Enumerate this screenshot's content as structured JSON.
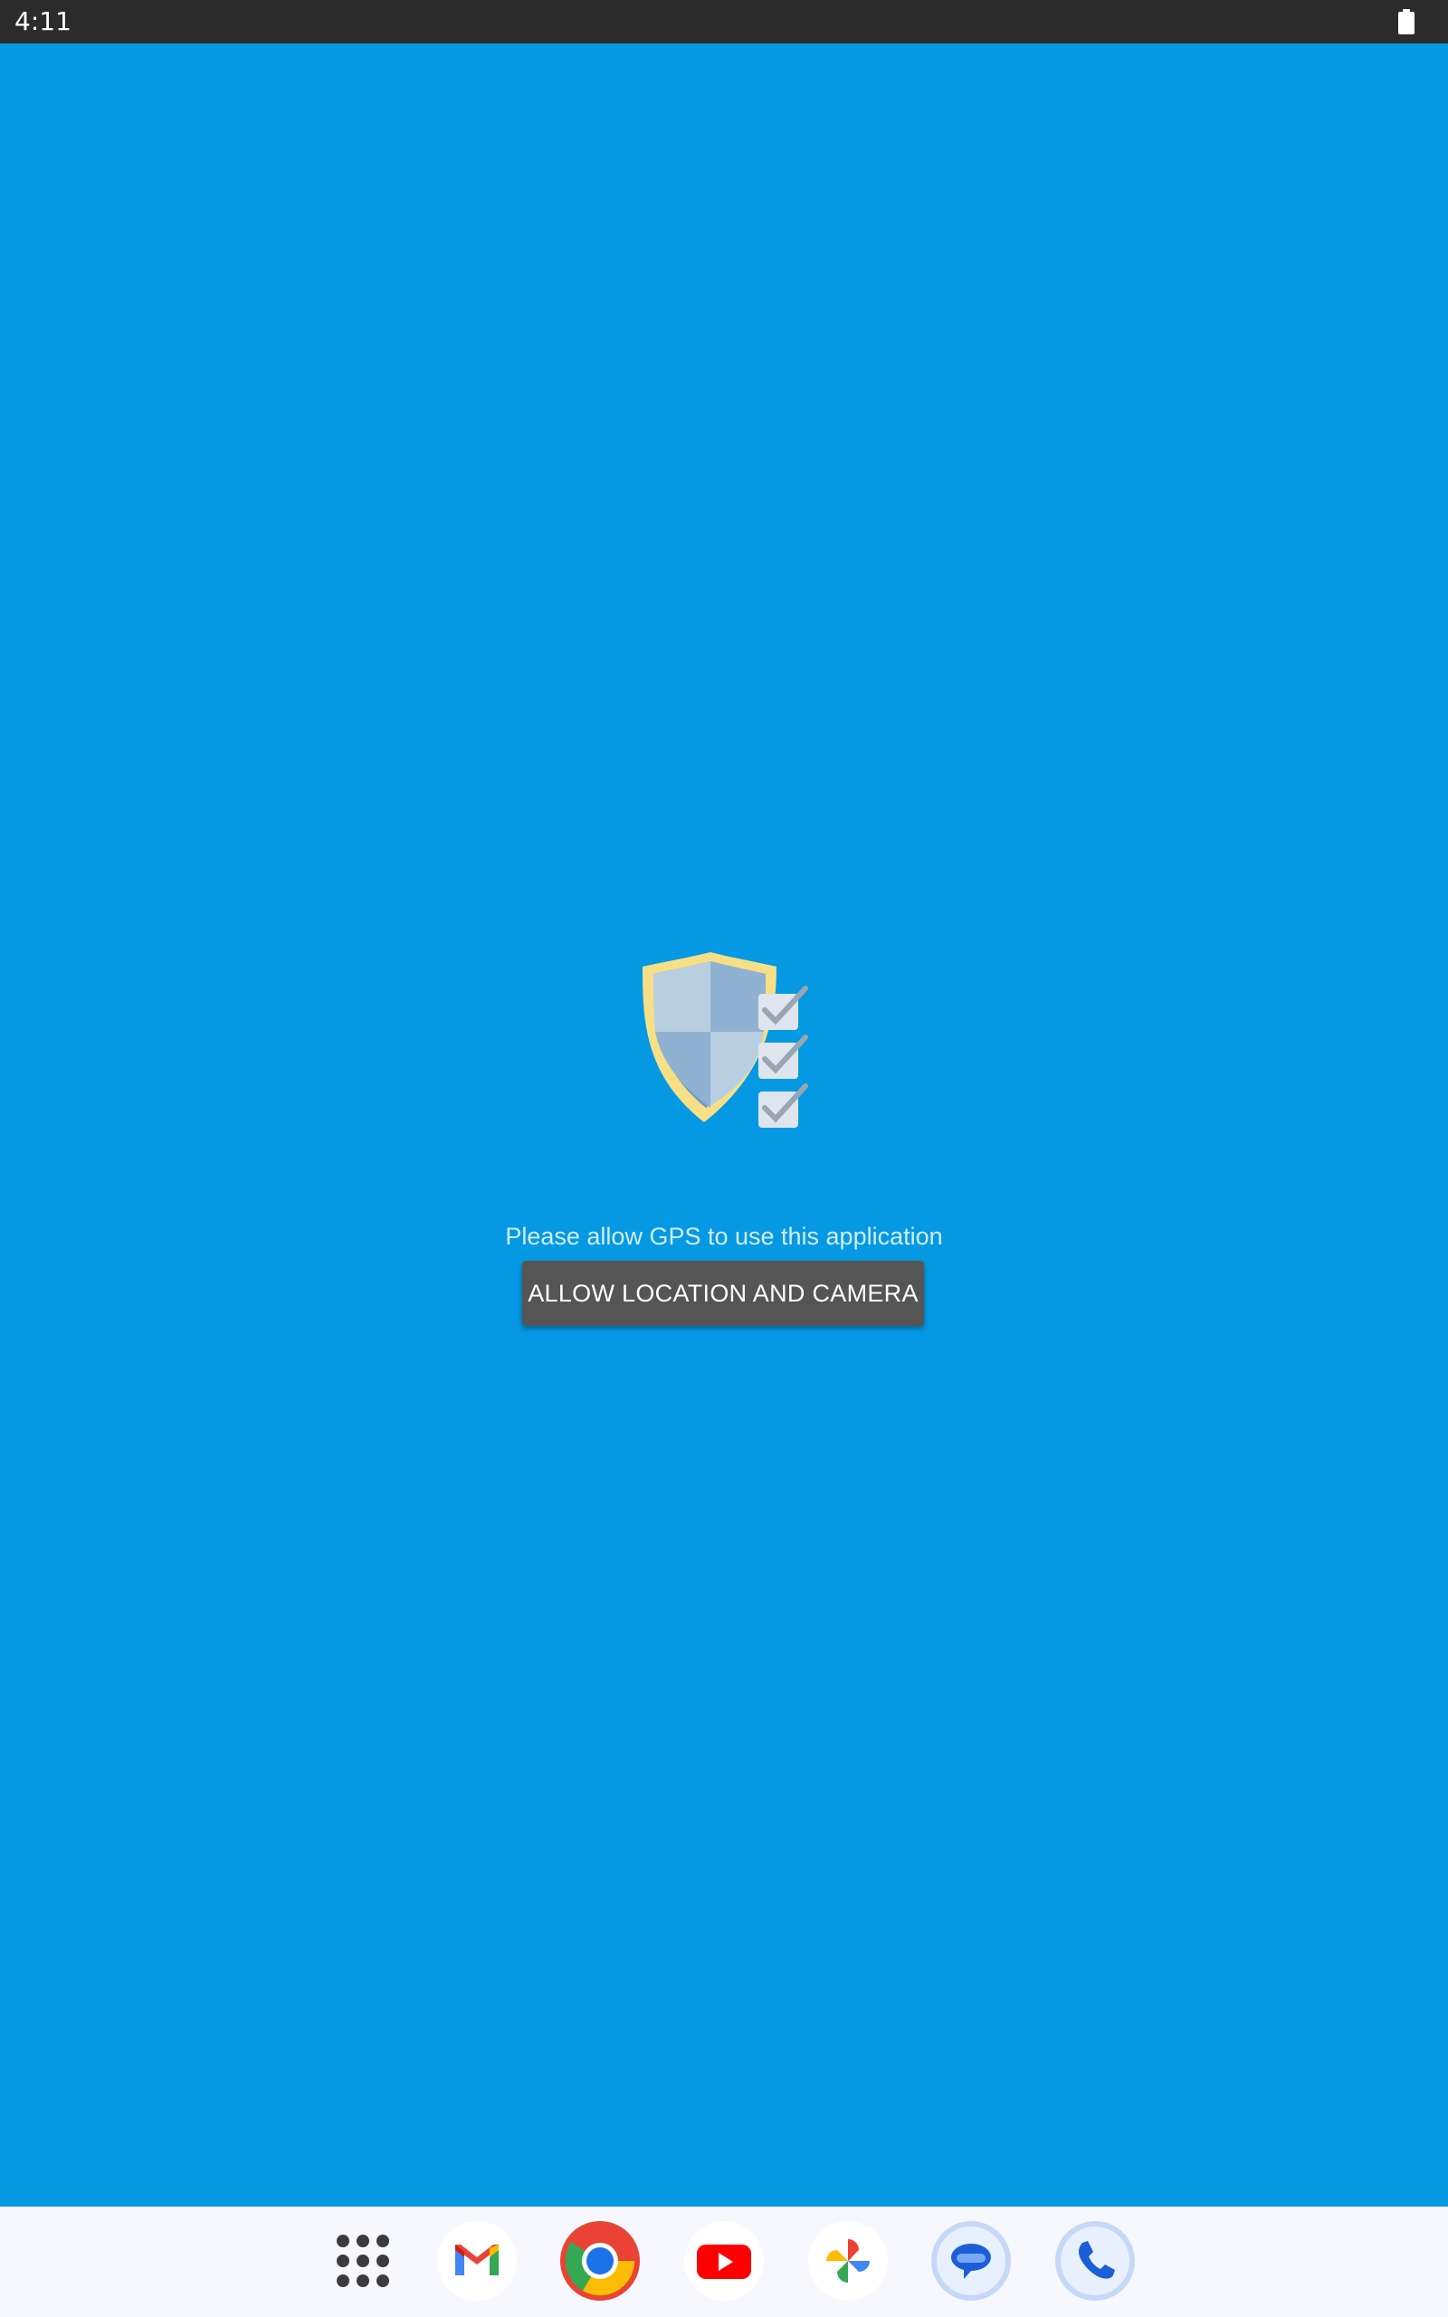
{
  "status_bar": {
    "time": "4:11",
    "battery_icon": "battery-full-icon"
  },
  "main": {
    "illustration_icon": "shield-checklist-icon",
    "message": "Please allow GPS to use this application",
    "allow_button_label": "ALLOW LOCATION AND CAMERA",
    "background_color": "#0499E2",
    "button_color": "#555555"
  },
  "dock": {
    "apps": [
      {
        "name": "App drawer",
        "icon": "app-drawer-icon"
      },
      {
        "name": "Gmail",
        "icon": "gmail-icon"
      },
      {
        "name": "Chrome",
        "icon": "chrome-icon"
      },
      {
        "name": "YouTube",
        "icon": "youtube-icon"
      },
      {
        "name": "Photos",
        "icon": "photos-icon"
      },
      {
        "name": "Messages",
        "icon": "messages-icon"
      },
      {
        "name": "Phone",
        "icon": "phone-icon"
      }
    ]
  }
}
